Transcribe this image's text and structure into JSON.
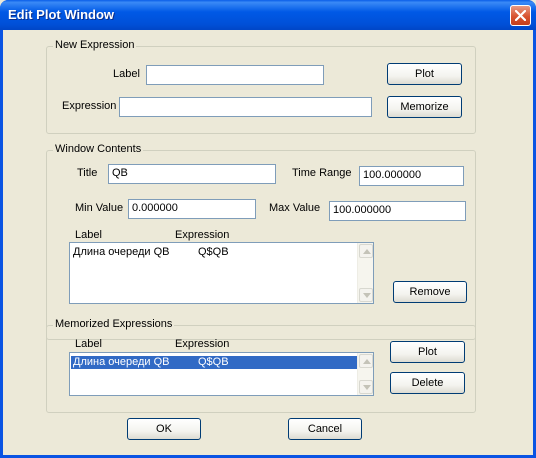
{
  "window": {
    "title": "Edit Plot Window"
  },
  "new_expression": {
    "group_title": "New Expression",
    "label_caption": "Label",
    "label_value": "",
    "expression_caption": "Expression",
    "expression_value": "",
    "plot_button": "Plot",
    "memorize_button": "Memorize"
  },
  "window_contents": {
    "group_title": "Window Contents",
    "title_caption": "Title",
    "title_value": "QB",
    "time_range_caption": "Time Range",
    "time_range_value": "100.000000",
    "min_value_caption": "Min Value",
    "min_value_value": "0.000000",
    "max_value_caption": "Max Value",
    "max_value_value": "100.000000",
    "list_headers": [
      "Label",
      "Expression"
    ],
    "rows": [
      {
        "label": "Длина очереди QB",
        "expression": "Q$QB"
      }
    ],
    "remove_button": "Remove"
  },
  "memorized": {
    "group_title": "Memorized Expressions",
    "list_headers": [
      "Label",
      "Expression"
    ],
    "rows": [
      {
        "label": "Длина очереди QB",
        "expression": "Q$QB",
        "selected": true
      }
    ],
    "plot_button": "Plot",
    "delete_button": "Delete"
  },
  "footer": {
    "ok_button": "OK",
    "cancel_button": "Cancel"
  },
  "colors": {
    "titlebar": "#0054e3",
    "dialog_bg": "#ece9d8",
    "selection": "#316ac5",
    "close_button": "#d8532f"
  }
}
